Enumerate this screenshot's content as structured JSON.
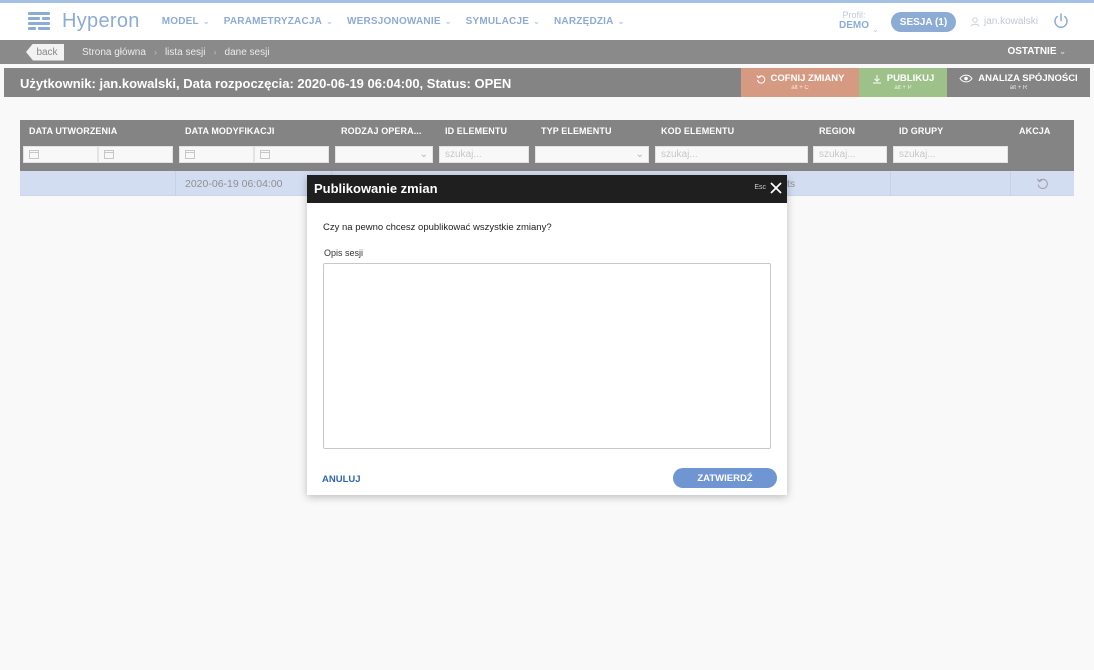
{
  "app": {
    "logo_text": "Hyperon",
    "nav": [
      {
        "label": "MODEL"
      },
      {
        "label": "PARAMETRYZACJA"
      },
      {
        "label": "WERSJONOWANIE"
      },
      {
        "label": "SYMULACJE"
      },
      {
        "label": "NARZĘDZIA"
      }
    ],
    "profile_label": "Profil:",
    "profile_value": "DEMO",
    "session_button": "SESJA (1)",
    "username": "jan.kowalski"
  },
  "breadcrumb": {
    "back_label": "back",
    "items": [
      "Strona główna",
      "lista sesji",
      "dane sesji"
    ],
    "recent_label": "OSTATNIE"
  },
  "titlebar": {
    "title": "Użytkownik: jan.kowalski, Data rozpoczęcia: 2020-06-19 06:04:00, Status: OPEN",
    "actions": [
      {
        "label": "COFNIJ ZMIANY",
        "shortcut": "alt + C",
        "color": "#b5461a"
      },
      {
        "label": "PUBLIKUJ",
        "shortcut": "alt + P",
        "color": "#4f8f2a"
      },
      {
        "label": "ANALIZA SPÓJNOŚCI",
        "shortcut": "alt + R",
        "color": "#1f1f1f"
      }
    ]
  },
  "table": {
    "columns": [
      "DATA UTWORZENIA",
      "DATA MODYFIKACJI",
      "RODZAJ OPERA...",
      "ID ELEMENTU",
      "TYP ELEMENTU",
      "KOD ELEMENTU",
      "REGION",
      "ID GRUPY",
      "AKCJA"
    ],
    "search_placeholder": "szukaj...",
    "rows": [
      {
        "data_utworzenia": "",
        "data_modyfikacji": "2020-06-19 06:04:00",
        "kod_elementu_fragment": "ts"
      }
    ]
  },
  "modal": {
    "title": "Publikowanie zmian",
    "esc_label": "Esc",
    "question": "Czy na pewno chcesz opublikować wszystkie zmiany?",
    "description_label": "Opis sesji",
    "description_value": "",
    "cancel_label": "ANULUJ",
    "confirm_label": "ZATWIERDŹ"
  },
  "colors": {
    "accent": "#2f66b3",
    "header_dark": "#1f1f1f",
    "row_selected": "#aec2e6",
    "undo": "#b5461a",
    "publish": "#4f8f2a",
    "confirm_button": "#6f95d2"
  }
}
